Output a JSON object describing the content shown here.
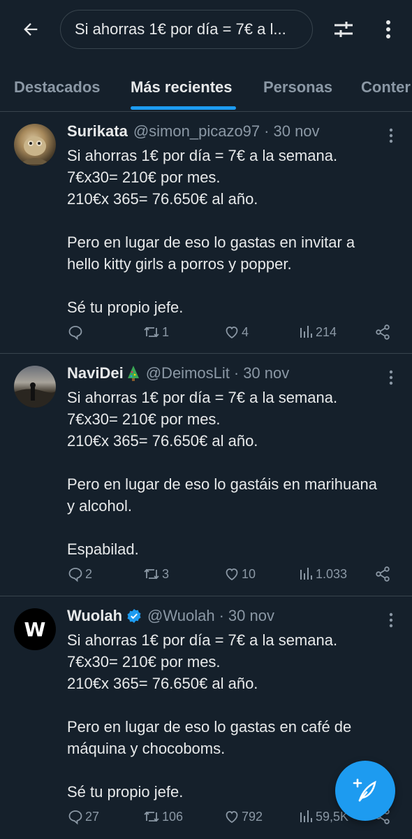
{
  "search": {
    "query": "Si ahorras 1€ por día = 7€ a l..."
  },
  "tabs": [
    {
      "label": "Destacados"
    },
    {
      "label": "Más recientes"
    },
    {
      "label": "Personas"
    },
    {
      "label": "Conter"
    }
  ],
  "tweets": [
    {
      "name": "Surikata",
      "handle": "@simon_picazo97",
      "dot": "·",
      "date": "30 nov",
      "lines": [
        "Si ahorras 1€ por día = 7€ a la semana.",
        "7€x30= 210€ por mes.",
        "210€x 365= 76.650€ al año.",
        "",
        "Pero en lugar de eso lo gastas en invitar a",
        "hello kitty girls a porros y popper.",
        "",
        "Sé tu propio jefe."
      ],
      "replies": "",
      "retweets": "1",
      "likes": "4",
      "views": "214"
    },
    {
      "name": "NaviDei",
      "handle": "@DeimosLit",
      "dot": "·",
      "date": "30 nov",
      "lines": [
        "Si ahorras 1€ por día = 7€ a la semana.",
        "7€x30= 210€ por mes.",
        "210€x 365= 76.650€ al año.",
        "",
        "Pero en lugar de eso lo gastáis en marihuana",
        "y alcohol.",
        "",
        "Espabilad."
      ],
      "replies": "2",
      "retweets": "3",
      "likes": "10",
      "views": "1.033"
    },
    {
      "name": "Wuolah",
      "handle": "@Wuolah",
      "dot": "·",
      "date": "30 nov",
      "avatar_letter": "W",
      "lines": [
        "Si ahorras 1€ por día = 7€ a la semana.",
        "7€x30= 210€ por mes.",
        "210€x 365= 76.650€ al año.",
        "",
        "Pero en lugar de eso lo gastas en café de",
        "máquina y chocoboms.",
        "",
        "Sé tu propio jefe."
      ],
      "replies": "27",
      "retweets": "106",
      "likes": "792",
      "views": "59,5K"
    }
  ],
  "colors": {
    "background": "#15202b",
    "accent": "#1d9bf0",
    "muted": "#8b98a5",
    "text": "#e7e9ea",
    "divider": "#38444d"
  },
  "icons": {
    "back": "arrow-left-icon",
    "filter": "sliders-icon",
    "more": "more-vertical-icon",
    "reply": "reply-icon",
    "retweet": "retweet-icon",
    "like": "heart-icon",
    "views": "views-icon",
    "share": "share-icon",
    "compose": "compose-icon",
    "verified": "verified-badge-icon",
    "tree": "christmas-tree-emoji"
  }
}
